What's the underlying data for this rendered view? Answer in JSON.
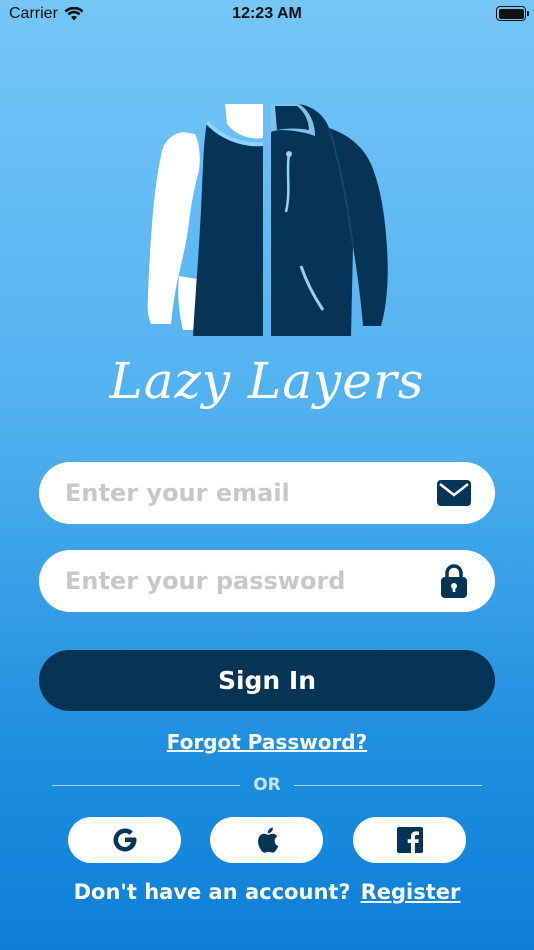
{
  "status_bar": {
    "carrier": "Carrier",
    "time": "12:23 AM"
  },
  "app": {
    "title": "Lazy Layers"
  },
  "login_form": {
    "email_placeholder": "Enter your email",
    "password_placeholder": "Enter your password",
    "signin_label": "Sign In",
    "forgot_label": "Forgot Password?",
    "or_label": "OR"
  },
  "social_buttons": [
    {
      "icon": "google-icon"
    },
    {
      "icon": "apple-icon"
    },
    {
      "icon": "facebook-icon"
    }
  ],
  "footer": {
    "prompt": "Don't have an account?",
    "register_label": "Register"
  },
  "colors": {
    "primary_dark": "#053454",
    "gradient_top": "#76c6f7",
    "gradient_bottom": "#0d7fd6",
    "placeholder": "#c7c7c7"
  }
}
